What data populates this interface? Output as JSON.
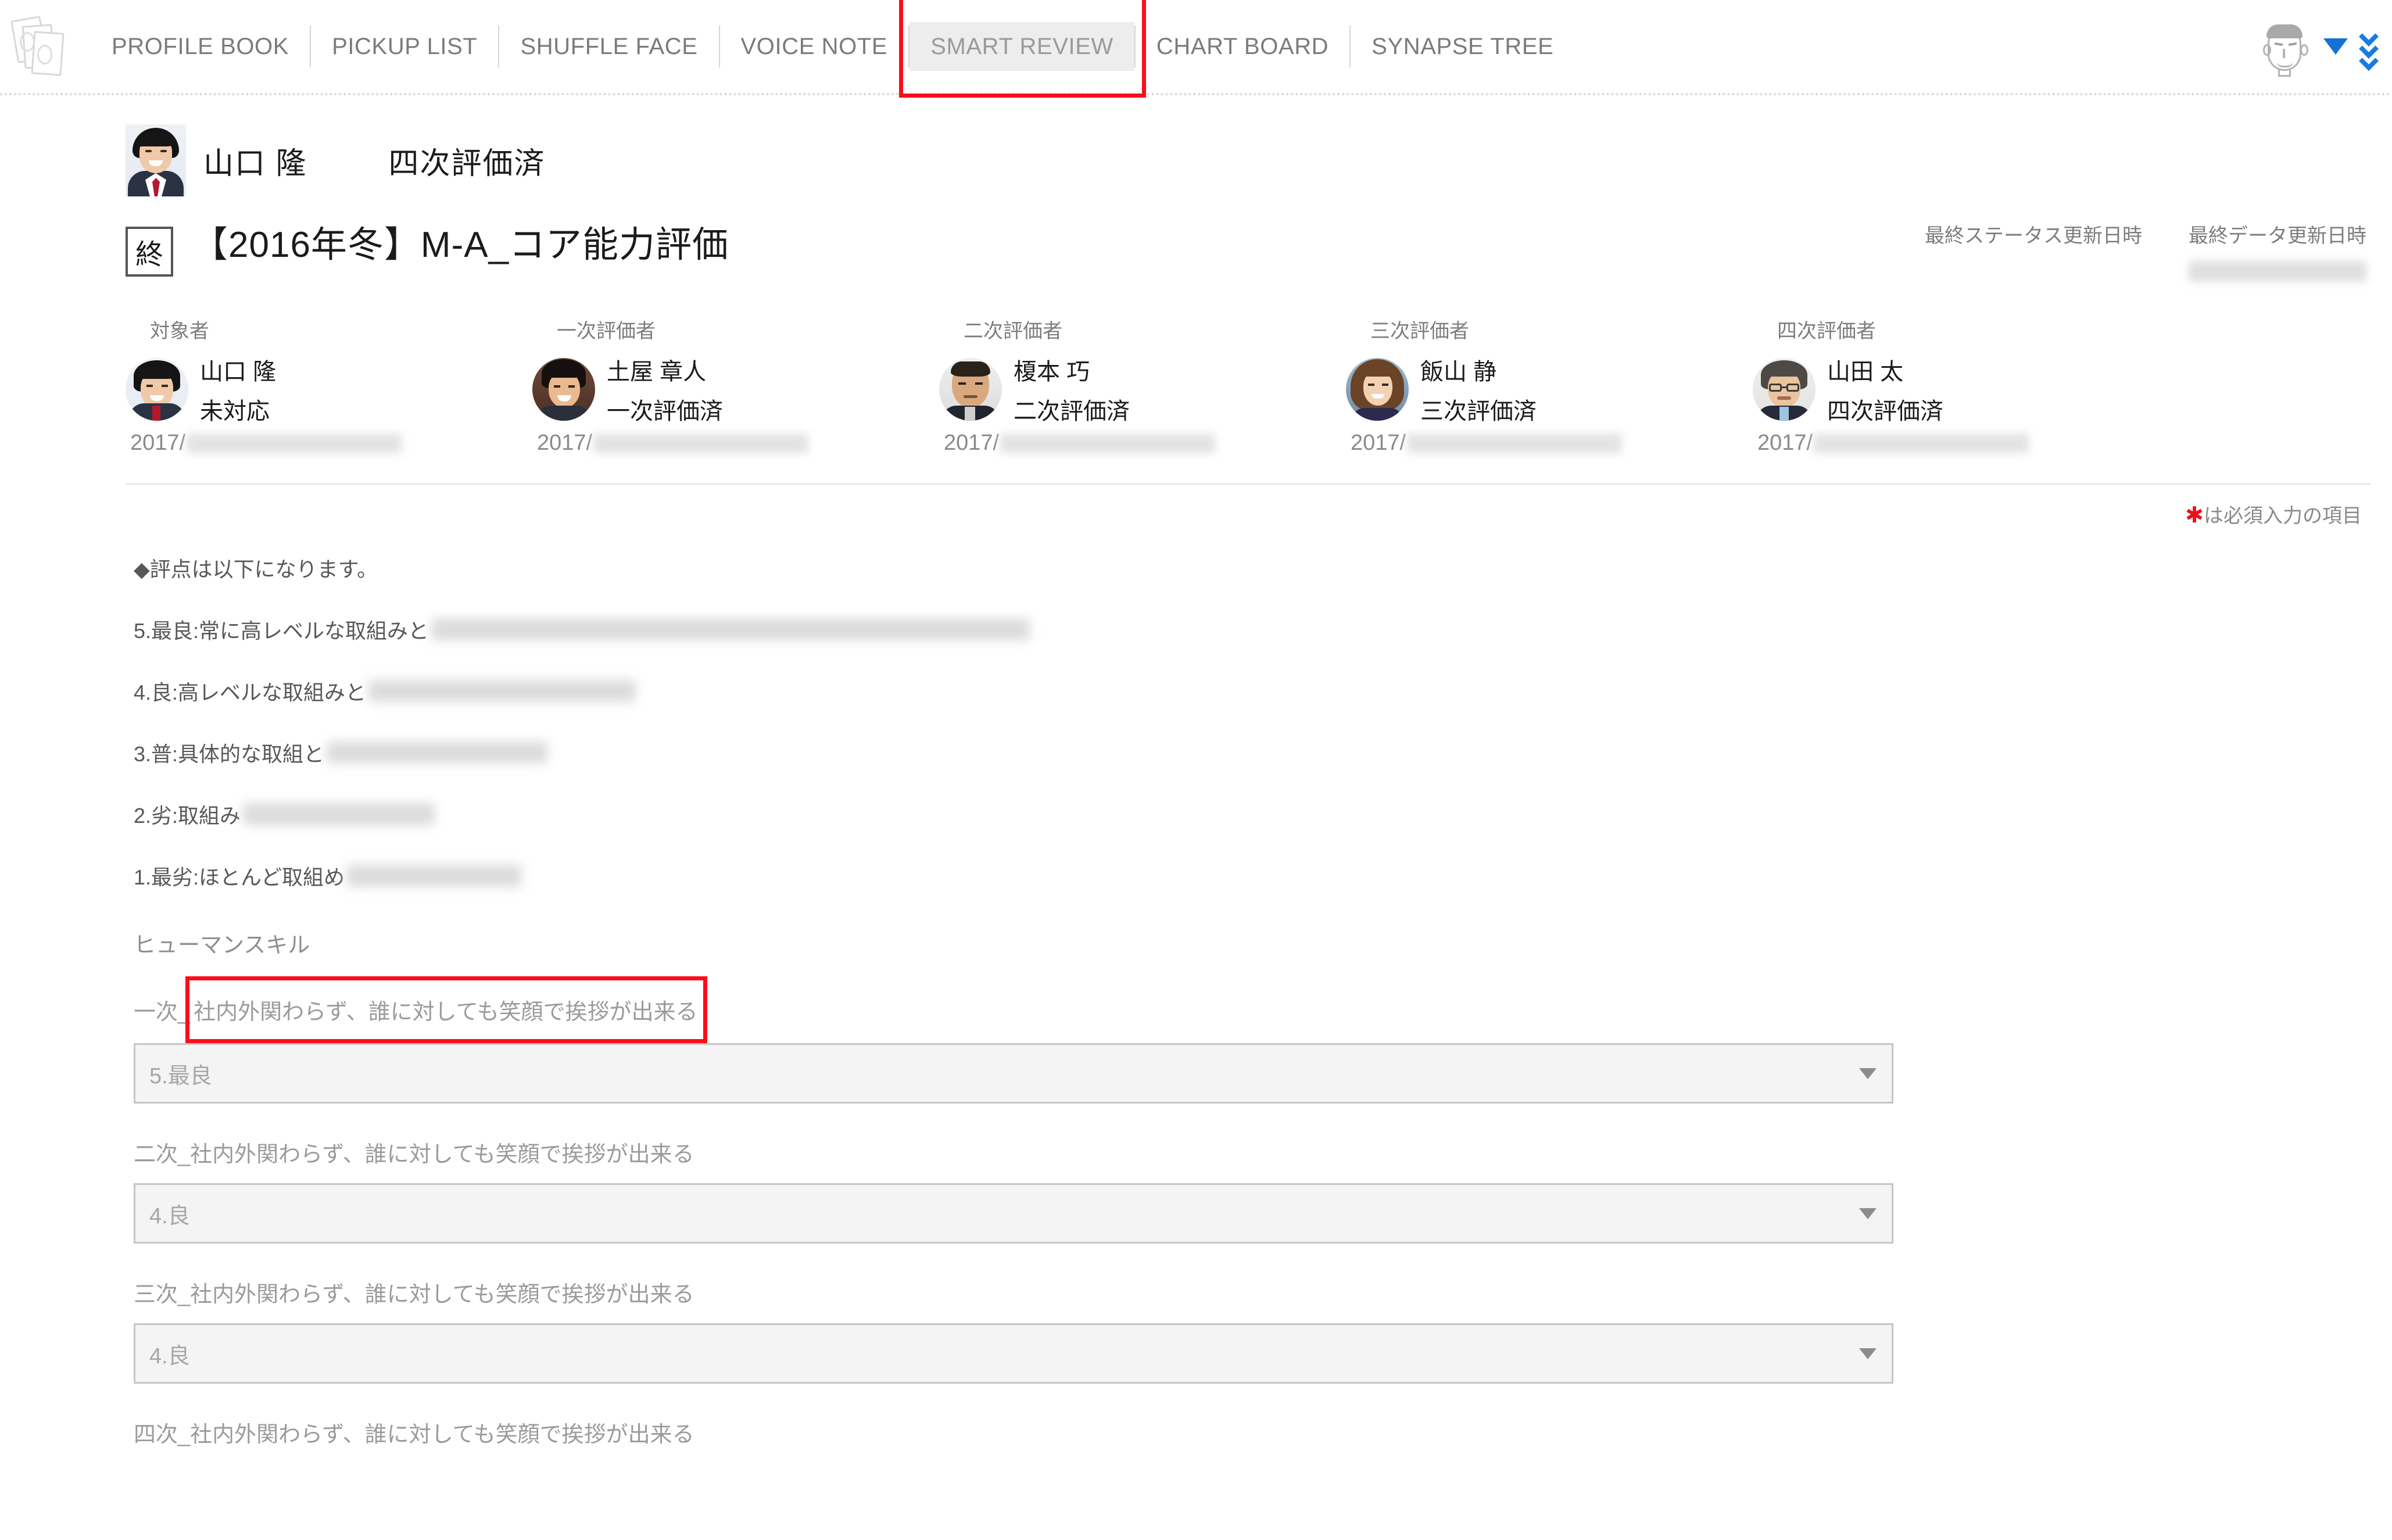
{
  "nav": {
    "logo_icon": "cards-logo-icon",
    "items": [
      {
        "label": "PROFILE BOOK",
        "active": false
      },
      {
        "label": "PICKUP LIST",
        "active": false
      },
      {
        "label": "SHUFFLE FACE",
        "active": false
      },
      {
        "label": "VOICE NOTE",
        "active": false
      },
      {
        "label": "SMART REVIEW",
        "active": true
      },
      {
        "label": "CHART BOARD",
        "active": false
      },
      {
        "label": "SYNAPSE TREE",
        "active": false
      }
    ],
    "user": {
      "avatar_icon": "user-face-icon",
      "dropdown_icon": "triangle-down-icon",
      "chevrons_icon": "double-chevron-down-icon"
    }
  },
  "person": {
    "avatar_icon": "employee-photo",
    "name": "山口 隆",
    "status": "四次評価済"
  },
  "document": {
    "badge": "終",
    "title": "【2016年冬】M-A_コア能力評価",
    "meta": [
      {
        "label": "最終ステータス更新日時",
        "value_blurred": true,
        "value_empty": true
      },
      {
        "label": "最終データ更新日時",
        "value_blurred": true,
        "value_empty": false
      }
    ]
  },
  "evaluators": [
    {
      "role": "対象者",
      "name": "山口 隆",
      "state": "未対応",
      "date_prefix": "2017/",
      "date_blurred": true
    },
    {
      "role": "一次評価者",
      "name": "土屋 章人",
      "state": "一次評価済",
      "date_prefix": "2017/",
      "date_blurred": true
    },
    {
      "role": "二次評価者",
      "name": "榎本 巧",
      "state": "二次評価済",
      "date_prefix": "2017/",
      "date_blurred": true
    },
    {
      "role": "三次評価者",
      "name": "飯山 静",
      "state": "三次評価済",
      "date_prefix": "2017/",
      "date_blurred": true
    },
    {
      "role": "四次評価者",
      "name": "山田 太",
      "state": "四次評価済",
      "date_prefix": "2017/",
      "date_blurred": true
    }
  ],
  "required_note": {
    "star": "✱",
    "text": "は必須入力の項目"
  },
  "legend": {
    "heading": "◆評点は以下になります。",
    "lines": [
      {
        "visible": "5.最良:常に高レベルな取組みと",
        "blurred_width": 1030
      },
      {
        "visible": "4.良:高レベルな取組みと",
        "blurred_width": 460
      },
      {
        "visible": "3.普:具体的な取組と",
        "blurred_width": 380
      },
      {
        "visible": "2.劣:取組み",
        "blurred_width": 330
      },
      {
        "visible": "1.最劣:ほとんど取組め",
        "blurred_width": 300
      }
    ]
  },
  "section": {
    "heading": "ヒューマンスキル"
  },
  "fields": [
    {
      "prefix": "一次_",
      "label": "社内外関わらず、誰に対しても笑顔で挨拶が出来る",
      "highlighted": true,
      "value": "5.最良",
      "arrow_icon": "chevron-down-icon"
    },
    {
      "prefix": "二次_",
      "label": "社内外関わらず、誰に対しても笑顔で挨拶が出来る",
      "highlighted": false,
      "value": "4.良",
      "arrow_icon": "chevron-down-icon"
    },
    {
      "prefix": "三次_",
      "label": "社内外関わらず、誰に対しても笑顔で挨拶が出来る",
      "highlighted": false,
      "value": "4.良",
      "arrow_icon": "chevron-down-icon"
    },
    {
      "prefix": "四次_",
      "label": "社内外関わらず、誰に対しても笑顔で挨拶が出来る",
      "highlighted": false,
      "value": "",
      "arrow_icon": "chevron-down-icon"
    }
  ],
  "colors": {
    "highlight_red": "#fc0d1b",
    "accent_blue": "#1472d6",
    "required_red": "#e8111c"
  }
}
